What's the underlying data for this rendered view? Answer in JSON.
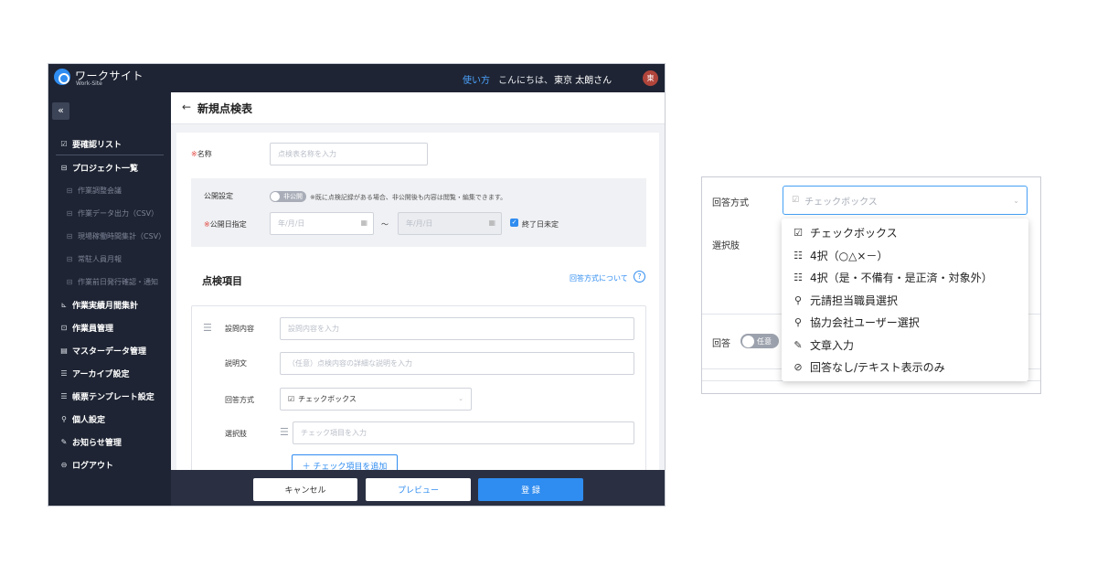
{
  "header": {
    "logo_title": "ワークサイト",
    "logo_sub": "Work-Site",
    "help_link": "使い方",
    "greeting": "こんにちは、",
    "user_name": "東京 太朗さん",
    "avatar_initial": "東"
  },
  "sidebar": {
    "collapse": "«",
    "items": [
      {
        "icon": "☑",
        "label": "要確認リスト",
        "sub": false
      },
      {
        "icon": "⊟",
        "label": "プロジェクト一覧",
        "sub": false
      },
      {
        "icon": "⊟",
        "label": "作業調整会議",
        "sub": true
      },
      {
        "icon": "⊟",
        "label": "作業データ出力（CSV）",
        "sub": true
      },
      {
        "icon": "⊟",
        "label": "現場稼働時間集計（CSV）",
        "sub": true
      },
      {
        "icon": "⊟",
        "label": "常駐人員月報",
        "sub": true
      },
      {
        "icon": "⊟",
        "label": "作業前日発行確認・通知",
        "sub": true
      },
      {
        "icon": "⊾",
        "label": "作業実績月間集計",
        "sub": false
      },
      {
        "icon": "⊡",
        "label": "作業員管理",
        "sub": false
      },
      {
        "icon": "▤",
        "label": "マスターデータ管理",
        "sub": false
      },
      {
        "icon": "☰",
        "label": "アーカイブ設定",
        "sub": false
      },
      {
        "icon": "☰",
        "label": "帳票テンプレート設定",
        "sub": false
      },
      {
        "icon": "⚲",
        "label": "個人設定",
        "sub": false
      },
      {
        "icon": "✎",
        "label": "お知らせ管理",
        "sub": false
      },
      {
        "icon": "⊖",
        "label": "ログアウト",
        "sub": false
      }
    ]
  },
  "page": {
    "back": "←",
    "title": "新規点検表"
  },
  "form": {
    "name_mark": "※",
    "name_label": "名称",
    "name_placeholder": "点検表名称を入力",
    "publish_label": "公開設定",
    "publish_toggle": "非公開",
    "publish_note": "※既に点検記録がある場合、非公開後も内容は閲覧・編集できます。",
    "date_mark": "※",
    "date_label": "公開日指定",
    "date_start": "年/月/日",
    "date_tilde": "～",
    "date_end": "年/月/日",
    "end_undecided": "終了日未定",
    "section_title": "点検項目",
    "about_link": "回答方式について",
    "question_label": "設問内容",
    "question_placeholder": "設問内容を入力",
    "description_label": "説明文",
    "description_placeholder": "（任意）点検内容の詳細な説明を入力",
    "answer_label": "回答方式",
    "answer_value": "チェックボックス",
    "choices_label": "選択肢",
    "choices_placeholder": "チェック項目を入力",
    "add_item": "＋ チェック項目を追加"
  },
  "footer": {
    "cancel": "キャンセル",
    "preview": "プレビュー",
    "register": "登 録"
  },
  "zoom": {
    "answer_label": "回答方式",
    "selected": "チェックボックス",
    "choices_label": "選択肢",
    "answer_row_label": "回答",
    "answer_toggle": "任意",
    "options": [
      {
        "icon": "checkbox-icon",
        "glyph": "☑",
        "label": "チェックボックス"
      },
      {
        "icon": "list-icon",
        "glyph": "☷",
        "label": "4択（○△×－）"
      },
      {
        "icon": "list-icon",
        "glyph": "☷",
        "label": "4択（是・不備有・是正済・対象外）"
      },
      {
        "icon": "person-icon",
        "glyph": "⚲",
        "label": "元請担当職員選択"
      },
      {
        "icon": "person-icon",
        "glyph": "⚲",
        "label": "協力会社ユーザー選択"
      },
      {
        "icon": "edit-icon",
        "glyph": "✎",
        "label": "文章入力"
      },
      {
        "icon": "no-icon",
        "glyph": "⊘",
        "label": "回答なし/テキスト表示のみ"
      }
    ]
  },
  "colors": {
    "navy": "#1e2433",
    "accent": "#2f8cf0",
    "required": "#e0443c"
  }
}
